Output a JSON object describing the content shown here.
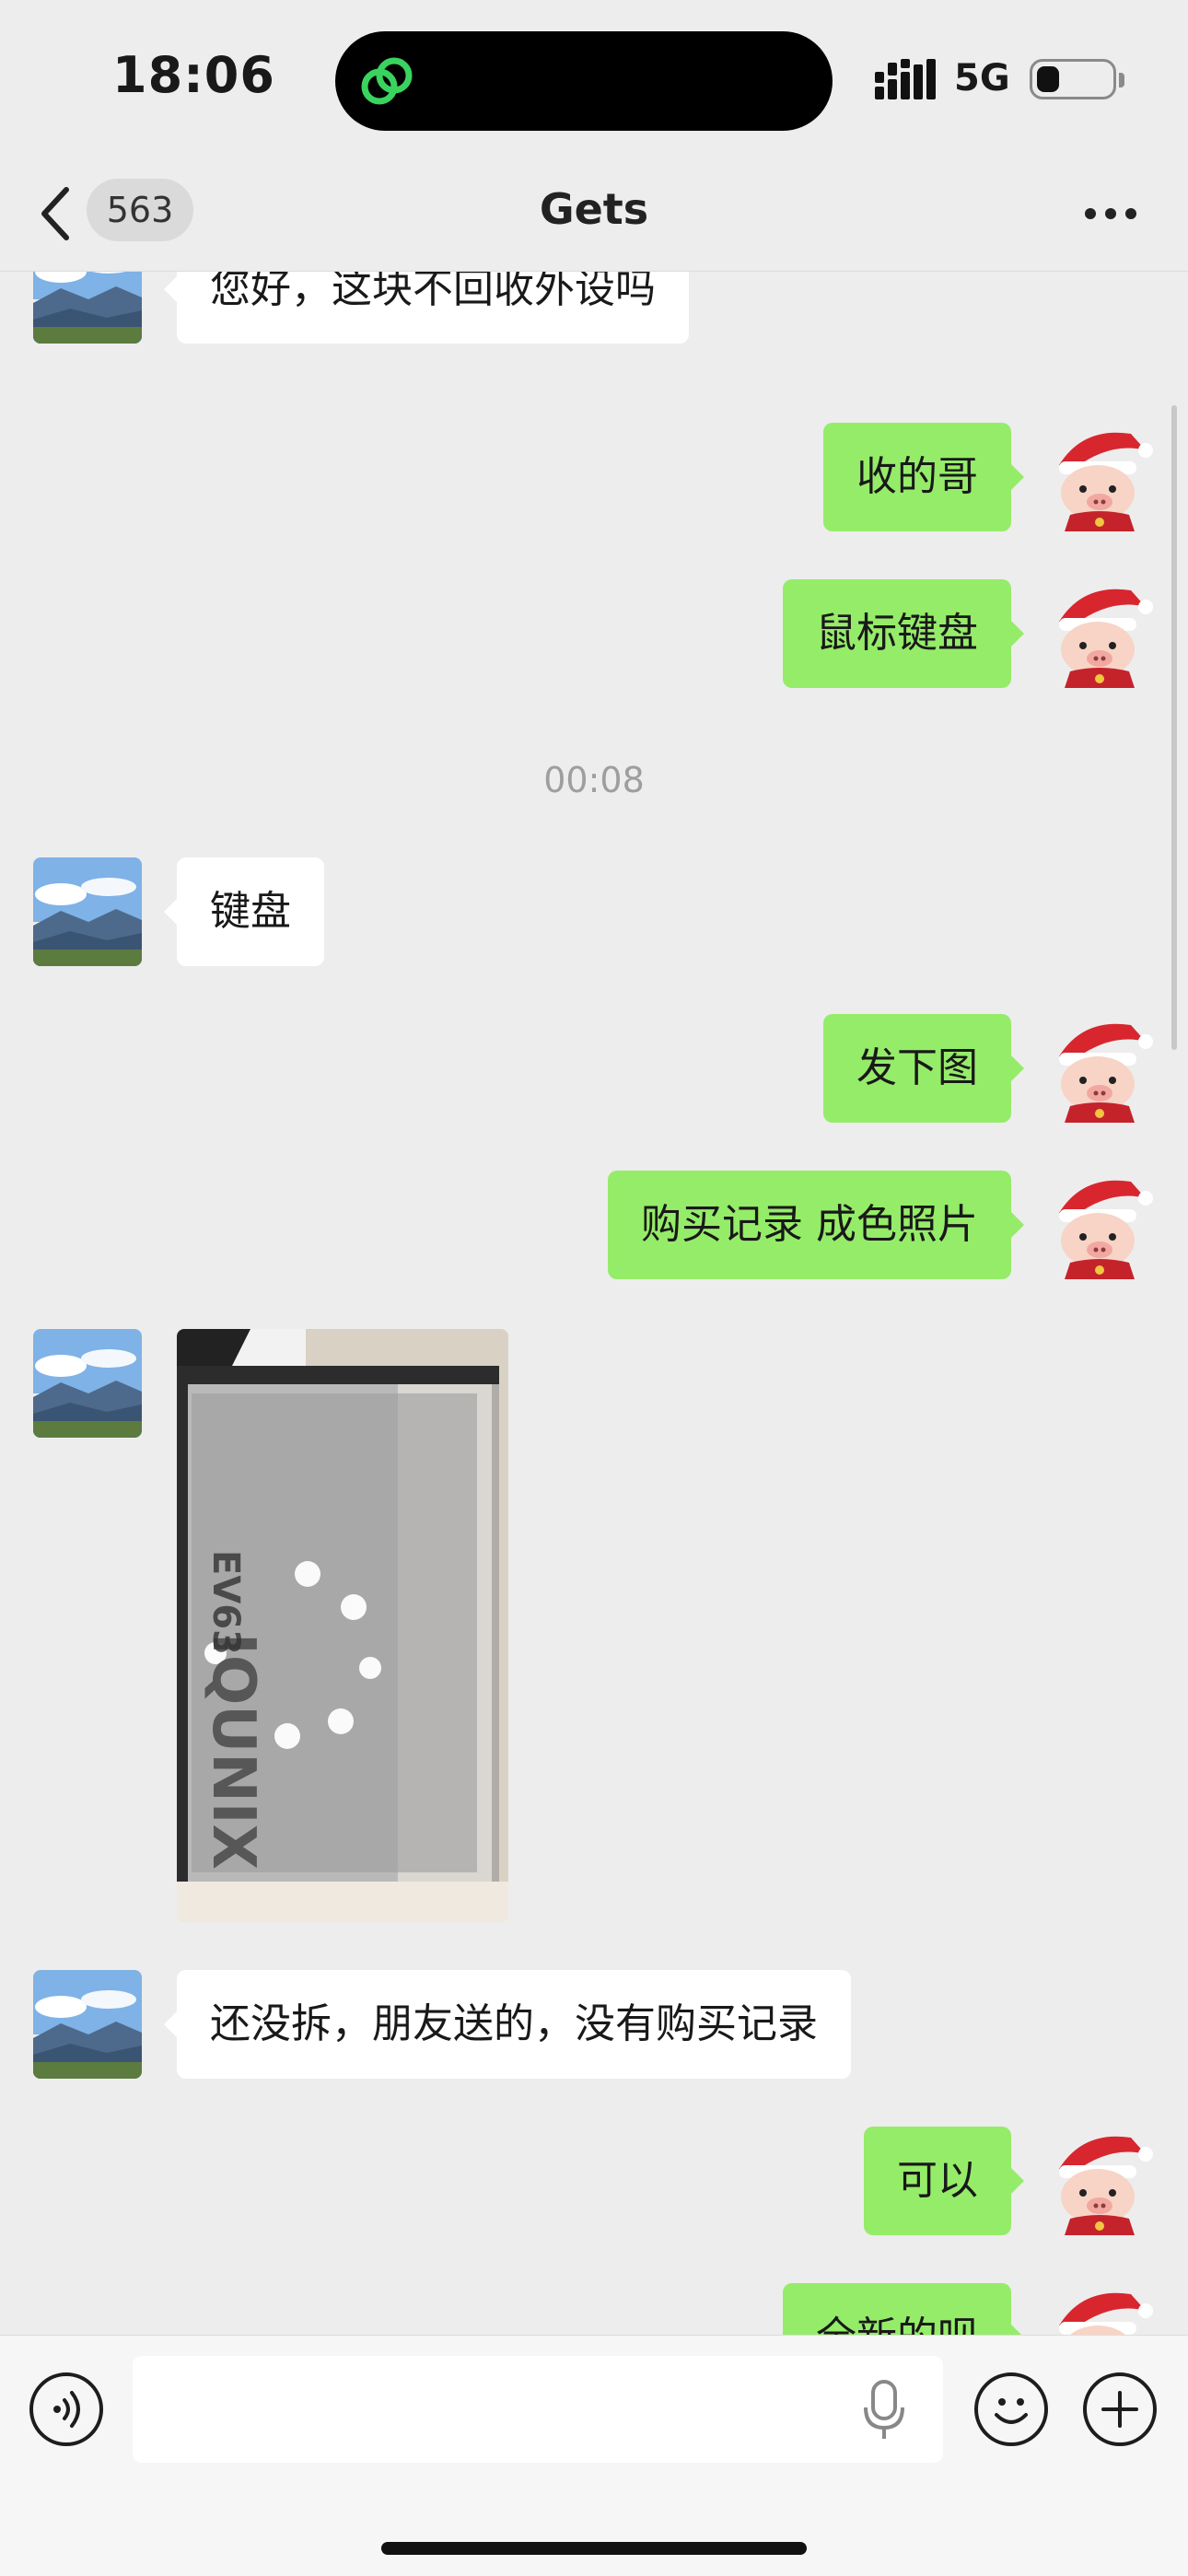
{
  "status_bar": {
    "time": "18:06",
    "network": "5G"
  },
  "nav": {
    "unread_count": "563",
    "title": "Gets"
  },
  "messages": [
    {
      "side": "in",
      "type": "text",
      "text": "您好，这块不回收外设吗"
    },
    {
      "side": "out",
      "type": "text",
      "text": "收的哥"
    },
    {
      "side": "out",
      "type": "text",
      "text": "鼠标键盘"
    },
    {
      "type": "time",
      "text": "00:08"
    },
    {
      "side": "in",
      "type": "text",
      "text": "键盘"
    },
    {
      "side": "out",
      "type": "text",
      "text": "发下图"
    },
    {
      "side": "out",
      "type": "text",
      "text": "购买记录 成色照片"
    },
    {
      "side": "in",
      "type": "image",
      "photo_text": [
        "IQUNIX",
        "EV63"
      ]
    },
    {
      "side": "in",
      "type": "text",
      "text": "还没拆，朋友送的，没有购买记录"
    },
    {
      "side": "out",
      "type": "text",
      "text": "可以"
    },
    {
      "side": "out",
      "type": "text",
      "text": "全新的呗"
    }
  ],
  "colors": {
    "out_bubble": "#95ec69",
    "in_bubble": "#ffffff",
    "background": "#ededed"
  },
  "icons": {
    "back": "chevron-left-icon",
    "more": "more-dots-icon",
    "voice": "voice-icon",
    "mic": "microphone-icon",
    "emoji": "emoji-icon",
    "add": "plus-icon"
  }
}
